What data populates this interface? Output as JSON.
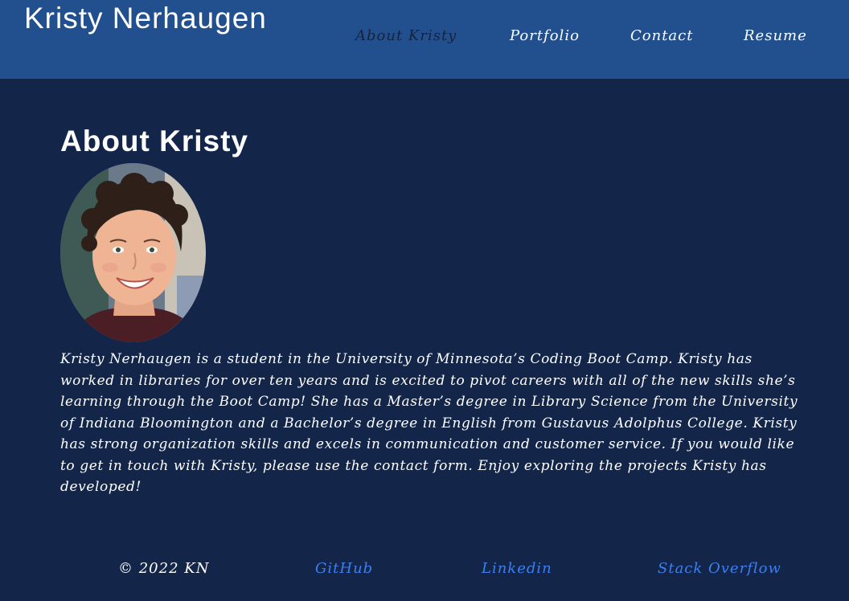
{
  "header": {
    "site_title": "Kristy Nerhaugen",
    "nav": [
      {
        "label": "About Kristy",
        "active": true
      },
      {
        "label": "Portfolio",
        "active": false
      },
      {
        "label": "Contact",
        "active": false
      },
      {
        "label": "Resume",
        "active": false
      }
    ]
  },
  "main": {
    "heading": "About Kristy",
    "bio": "Kristy Nerhaugen is a student in the University of Minnesota’s Coding Boot Camp. Kristy has worked in libraries for over ten years and is excited to pivot careers with all of the new skills she’s learning through the Boot Camp! She has a Master’s degree in Library Science from the University of Indiana Bloomington and a Bachelor’s degree in English from Gustavus Adolphus College. Kristy has strong organization skills and excels in communication and customer service. If you would like to get in touch with Kristy, please use the contact form. Enjoy exploring the projects Kristy has developed!"
  },
  "footer": {
    "copyright": "© 2022 KN",
    "links": [
      {
        "label": "GitHub"
      },
      {
        "label": "Linkedin"
      },
      {
        "label": "Stack Overflow"
      }
    ]
  },
  "colors": {
    "header_bg": "#22508f",
    "page_bg": "#13264a",
    "active_nav": "#1b2237",
    "link": "#3d7ff0",
    "text": "#ffffff"
  }
}
